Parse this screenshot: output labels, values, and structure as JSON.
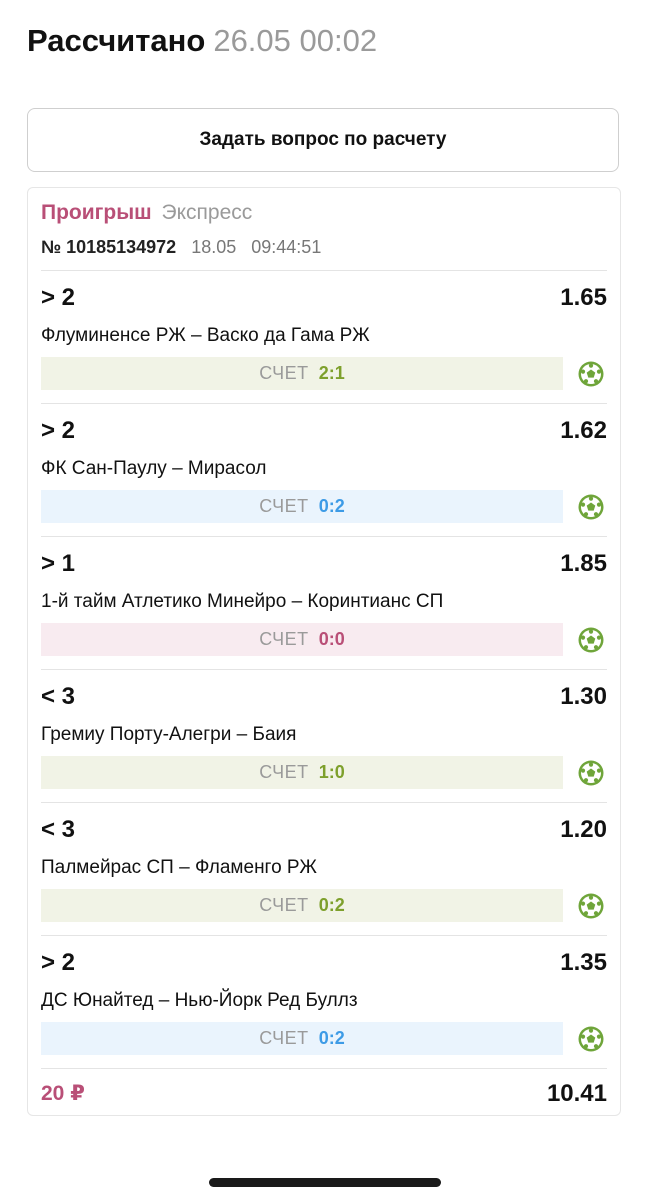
{
  "header": {
    "title": "Рассчитано",
    "datetime": "26.05 00:02"
  },
  "ask_button": {
    "label": "Задать вопрос по расчету"
  },
  "bet": {
    "status": "Проигрыш",
    "type": "Экспресс",
    "number": "№ 10185134972",
    "date": "18.05",
    "time": "09:44:51",
    "score_label": "СЧЕТ",
    "events": [
      {
        "outcome": "> 2",
        "odds": "1.65",
        "match": "Флуминенсе РЖ – Васко да Гама РЖ",
        "score": "2:1",
        "result_color": "green",
        "icon": "soccer-ball-icon"
      },
      {
        "outcome": "> 2",
        "odds": "1.62",
        "match": "ФК Сан-Паулу – Мирасол",
        "score": "0:2",
        "result_color": "blue",
        "icon": "soccer-ball-icon"
      },
      {
        "outcome": "> 1",
        "odds": "1.85",
        "match": "1-й тайм Атлетико Минейро – Коринтианс СП",
        "score": "0:0",
        "result_color": "pink",
        "icon": "soccer-ball-icon"
      },
      {
        "outcome": "< 3",
        "odds": "1.30",
        "match": "Гремиу Порту-Алегри – Баия",
        "score": "1:0",
        "result_color": "green",
        "icon": "soccer-ball-icon"
      },
      {
        "outcome": "< 3",
        "odds": "1.20",
        "match": "Палмейрас СП – Фламенго РЖ",
        "score": "0:2",
        "result_color": "green",
        "icon": "soccer-ball-icon"
      },
      {
        "outcome": "> 2",
        "odds": "1.35",
        "match": "ДС Юнайтед – Нью-Йорк Ред Буллз",
        "score": "0:2",
        "result_color": "blue",
        "icon": "soccer-ball-icon"
      }
    ],
    "stake": "20 ₽",
    "total_odds": "10.41"
  },
  "colors": {
    "loss": "#b94f77",
    "win_green": "#7ea02c",
    "blue": "#3d9be6",
    "ball_green": "#6fa53a"
  }
}
